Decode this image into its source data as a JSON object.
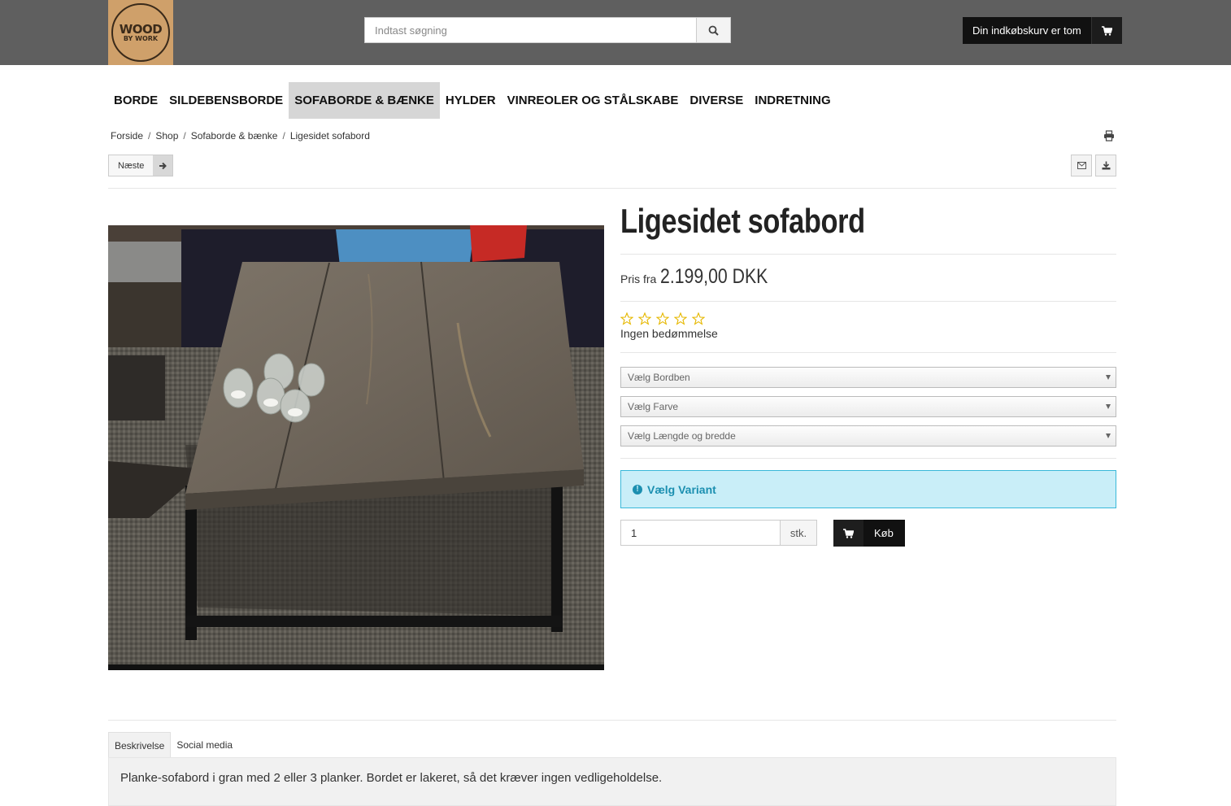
{
  "header": {
    "logo": {
      "line1": "WOOD",
      "line2": "BY WORK"
    },
    "search": {
      "placeholder": "Indtast søgning"
    },
    "cart": {
      "label": "Din indkøbskurv er tom"
    }
  },
  "nav": {
    "items": [
      {
        "label": "BORDE"
      },
      {
        "label": "SILDEBENSBORDE"
      },
      {
        "label": "SOFABORDE & BÆNKE"
      },
      {
        "label": "HYLDER"
      },
      {
        "label": "VINREOLER OG STÅLSKABE"
      },
      {
        "label": "DIVERSE"
      },
      {
        "label": "INDRETNING"
      }
    ],
    "active": "SOFABORDE & BÆNKE"
  },
  "breadcrumb": {
    "items": [
      "Forside",
      "Shop",
      "Sofaborde & bænke",
      "Ligesidet sofabord"
    ],
    "separator": "/"
  },
  "pager": {
    "next_label": "Næste"
  },
  "product": {
    "title": "Ligesidet sofabord",
    "price_label": "Pris fra",
    "price": "2.199,00 DKK",
    "rating_stars": 0,
    "rating_max": 5,
    "rating_text": "Ingen bedømmelse",
    "selects": [
      {
        "value": "Vælg Bordben"
      },
      {
        "value": "Vælg Farve"
      },
      {
        "value": "Vælg Længde og bredde"
      }
    ],
    "variant_alert": "Vælg Variant",
    "quantity": "1",
    "quantity_unit": "stk.",
    "buy_label": "Køb"
  },
  "tabs": {
    "items": [
      {
        "label": "Beskrivelse"
      },
      {
        "label": "Social media"
      }
    ],
    "active": "Beskrivelse",
    "description": "Planke-sofabord i gran med 2 eller 3 planker. Bordet er lakeret, så det kræver ingen vedligeholdelse."
  },
  "colors": {
    "header_bg": "#5f5f5f",
    "accent_info": "#1b8fb0",
    "info_bg": "#c9eef8",
    "star": "#e6b800"
  }
}
